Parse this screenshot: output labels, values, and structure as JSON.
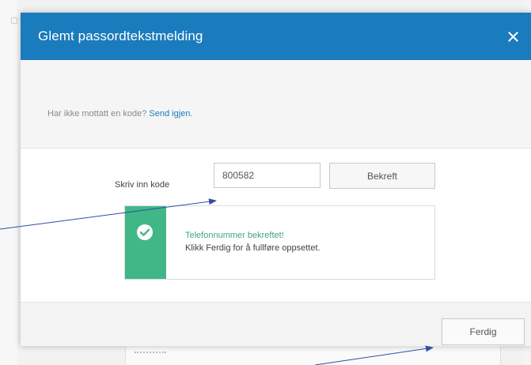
{
  "dialog": {
    "title": "Glemt passordtekstmelding",
    "close_icon": "close-icon"
  },
  "info": {
    "prompt": "Har ikke mottatt en kode?",
    "send_again": "Send igjen."
  },
  "code": {
    "label": "Skriv inn kode",
    "value": "800582",
    "confirm_label": "Bekreft"
  },
  "success": {
    "icon": "check-circle-icon",
    "title": "Telefonnummer bekreftet!",
    "message": "Klikk Ferdig for å fullføre oppsettet."
  },
  "footer": {
    "done_label": "Ferdig"
  },
  "colors": {
    "header": "#1a7bbd",
    "success_green": "#41b787",
    "link": "#1a7bbd",
    "annotation_arrow": "#2f4ea3"
  }
}
